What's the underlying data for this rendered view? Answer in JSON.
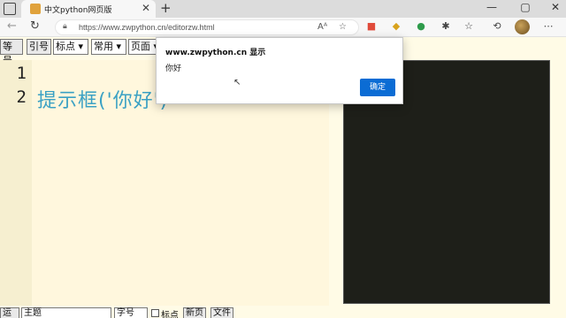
{
  "browser": {
    "tab_title": "中文python网页版",
    "url": "https://www.zwpython.cn/editorzw.html",
    "new_tab": "+",
    "tab_close": "✕"
  },
  "toolbar": {
    "btn_equals": "等号",
    "btn_quote": "引号",
    "sel_punct": "标点 ▾",
    "sel_common": "常用 ▾",
    "sel_page": "页面 ▾"
  },
  "editor": {
    "line_numbers": [
      "1",
      "2"
    ],
    "line2": "提示框('你好')"
  },
  "bottom": {
    "run": "运行",
    "theme": "主题",
    "fontsize": "字号",
    "punct": "标点",
    "newpage": "新页",
    "file": "文件"
  },
  "dialog": {
    "title": "www.zwpython.cn 显示",
    "message": "你好",
    "ok": "确定"
  }
}
